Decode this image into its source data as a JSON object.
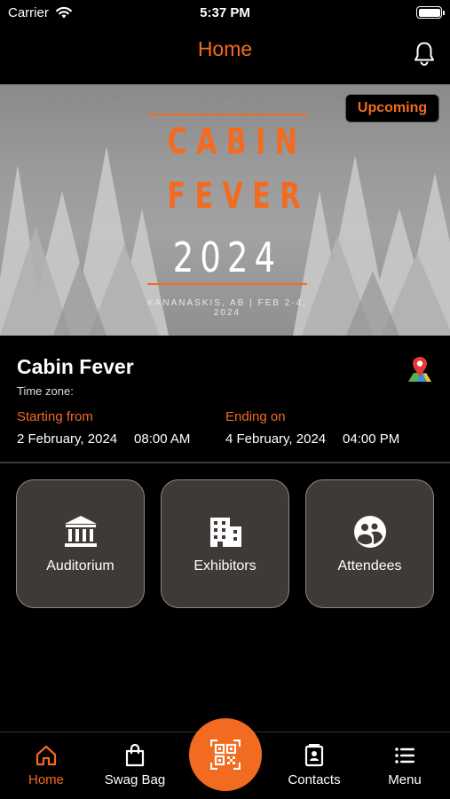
{
  "status_bar": {
    "carrier": "Carrier",
    "time": "5:37 PM"
  },
  "nav": {
    "title": "Home",
    "right_icon": "bell-icon"
  },
  "banner": {
    "badge": "Upcoming",
    "poster_line1": "CABIN",
    "poster_line2": "FEVER",
    "poster_year": "2024",
    "poster_subtitle": "KANANASKIS, AB | FEB 2-4, 2024"
  },
  "event": {
    "name": "Cabin Fever",
    "timezone_label": "Time zone:",
    "start_label": "Starting from",
    "start_date": "2 February, 2024",
    "start_time": "08:00 AM",
    "end_label": "Ending on",
    "end_date": "4 February, 2024",
    "end_time": "04:00 PM"
  },
  "tiles": [
    {
      "label": "Auditorium",
      "icon": "bank-icon"
    },
    {
      "label": "Exhibitors",
      "icon": "building-icon"
    },
    {
      "label": "Attendees",
      "icon": "people-icon"
    }
  ],
  "tabbar": {
    "items": [
      {
        "label": "Home",
        "icon": "home-icon",
        "active": true
      },
      {
        "label": "Swag Bag",
        "icon": "bag-icon"
      },
      {
        "label": "",
        "icon": "qr-scan-icon"
      },
      {
        "label": "Contacts",
        "icon": "contacts-icon"
      },
      {
        "label": "Menu",
        "icon": "menu-icon"
      }
    ]
  },
  "colors": {
    "accent": "#f26b21",
    "tile_bg": "#3f3a36",
    "background": "#000000"
  }
}
